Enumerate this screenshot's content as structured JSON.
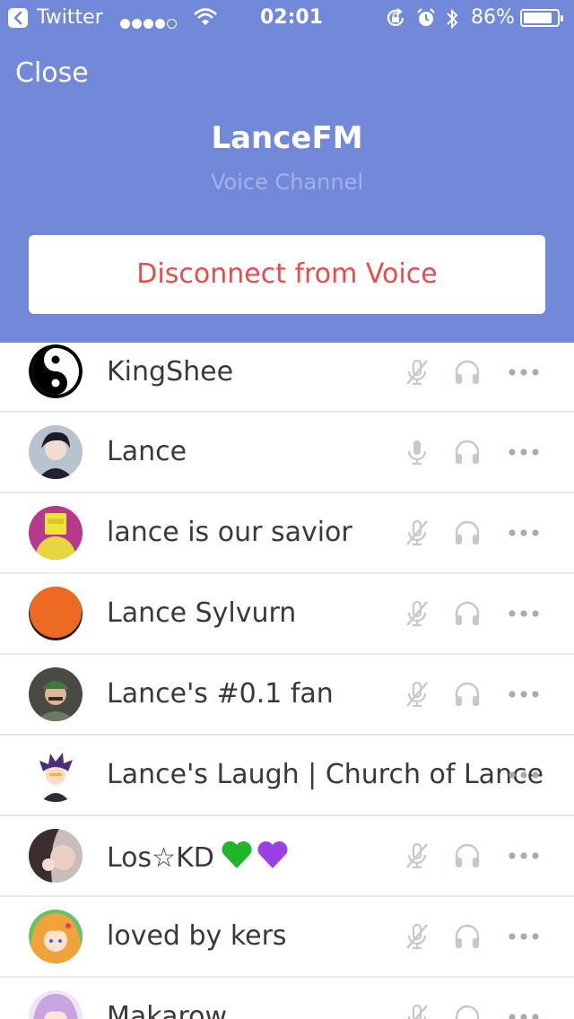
{
  "status_bar": {
    "back_app": "Twitter",
    "time": "02:01",
    "battery_text": "86%",
    "battery_level": 0.86
  },
  "header": {
    "close_label": "Close",
    "channel_name": "LanceFM",
    "channel_type": "Voice Channel",
    "disconnect_label": "Disconnect from Voice"
  },
  "colors": {
    "header_bg": "#7289da",
    "disconnect_text": "#e74c4c",
    "icon_muted": "#c4c9ce"
  },
  "members": [
    {
      "name": "KingShee",
      "mic_state": "muted",
      "avatar": "yin-yang-avatar"
    },
    {
      "name": "Lance",
      "mic_state": "on",
      "avatar": "dark-hair-avatar"
    },
    {
      "name": "lance is our savior",
      "mic_state": "muted",
      "avatar": "yellow-cube-avatar"
    },
    {
      "name": "Lance Sylvurn",
      "mic_state": "muted",
      "avatar": "orange-circle-avatar"
    },
    {
      "name": "Lance's #0.1 fan",
      "mic_state": "muted",
      "avatar": "green-cap-avatar"
    },
    {
      "name": "Lance's Laugh | Church of Lance",
      "mic_state": "hidden",
      "avatar": "purple-hair-avatar"
    },
    {
      "name": "Los☆KD",
      "mic_state": "muted",
      "avatar": "photo-avatar"
    },
    {
      "name": "loved by kers",
      "mic_state": "muted",
      "avatar": "anime-girl-avatar"
    },
    {
      "name": "Makarow",
      "mic_state": "muted",
      "avatar": "lilac-hair-avatar"
    }
  ]
}
